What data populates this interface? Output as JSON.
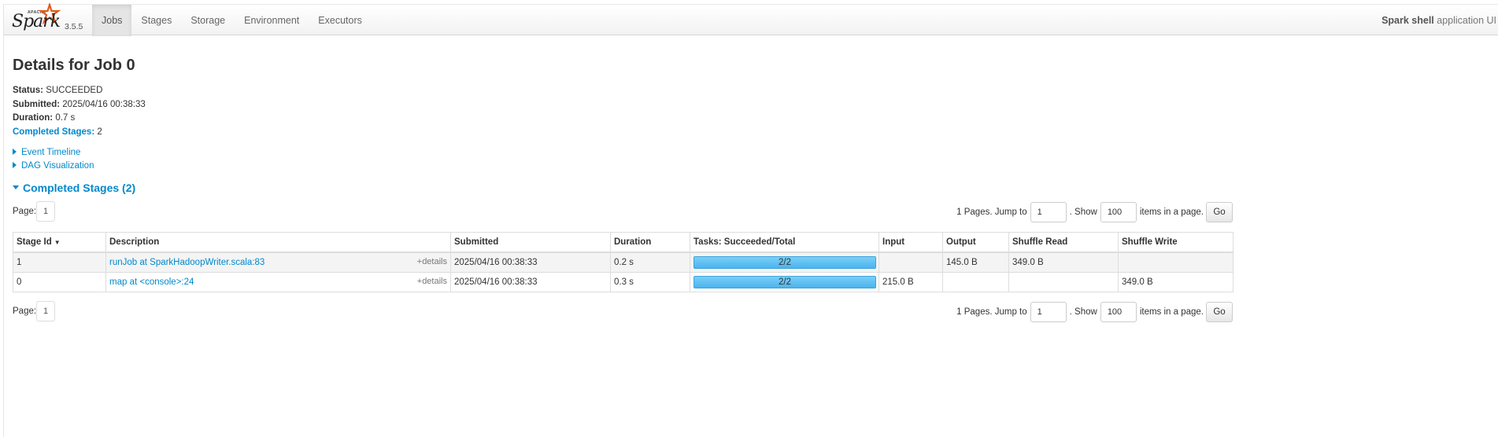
{
  "brand": {
    "apache": "APACHE",
    "name": "Spark",
    "version": "3.5.5"
  },
  "nav": {
    "tabs": [
      {
        "label": "Jobs",
        "active": true
      },
      {
        "label": "Stages",
        "active": false
      },
      {
        "label": "Storage",
        "active": false
      },
      {
        "label": "Environment",
        "active": false
      },
      {
        "label": "Executors",
        "active": false
      }
    ],
    "app_name": "Spark shell",
    "app_suffix": "application UI"
  },
  "page": {
    "title": "Details for Job 0",
    "summary": {
      "status_label": "Status:",
      "status_value": "SUCCEEDED",
      "submitted_label": "Submitted:",
      "submitted_value": "2025/04/16 00:38:33",
      "duration_label": "Duration:",
      "duration_value": "0.7 s",
      "completed_label": "Completed Stages:",
      "completed_value": "2"
    },
    "event_timeline": "Event Timeline",
    "dag_visualization": "DAG Visualization",
    "section_title": "Completed Stages (2)"
  },
  "paging": {
    "page_label": "Page:",
    "current_page": "1",
    "pages_text": "1 Pages. Jump to",
    "jump_value": "1",
    "show_text": ". Show",
    "show_value": "100",
    "items_text": "items in a page.",
    "go_label": "Go"
  },
  "table": {
    "columns": [
      "Stage Id",
      "Description",
      "Submitted",
      "Duration",
      "Tasks: Succeeded/Total",
      "Input",
      "Output",
      "Shuffle Read",
      "Shuffle Write"
    ],
    "sort_indicator": "▼",
    "details_label": "+details",
    "rows": [
      {
        "stage_id": "1",
        "description": "runJob at SparkHadoopWriter.scala:83",
        "submitted": "2025/04/16 00:38:33",
        "duration": "0.2 s",
        "tasks": "2/2",
        "tasks_fraction": 1.0,
        "input": "",
        "output": "145.0 B",
        "shuffle_read": "349.0 B",
        "shuffle_write": ""
      },
      {
        "stage_id": "0",
        "description": "map at <console>:24",
        "submitted": "2025/04/16 00:38:33",
        "duration": "0.3 s",
        "tasks": "2/2",
        "tasks_fraction": 1.0,
        "input": "215.0 B",
        "output": "",
        "shuffle_read": "",
        "shuffle_write": "349.0 B"
      }
    ]
  },
  "colors": {
    "link": "#0088cc",
    "progress": "#5bc0f5"
  }
}
